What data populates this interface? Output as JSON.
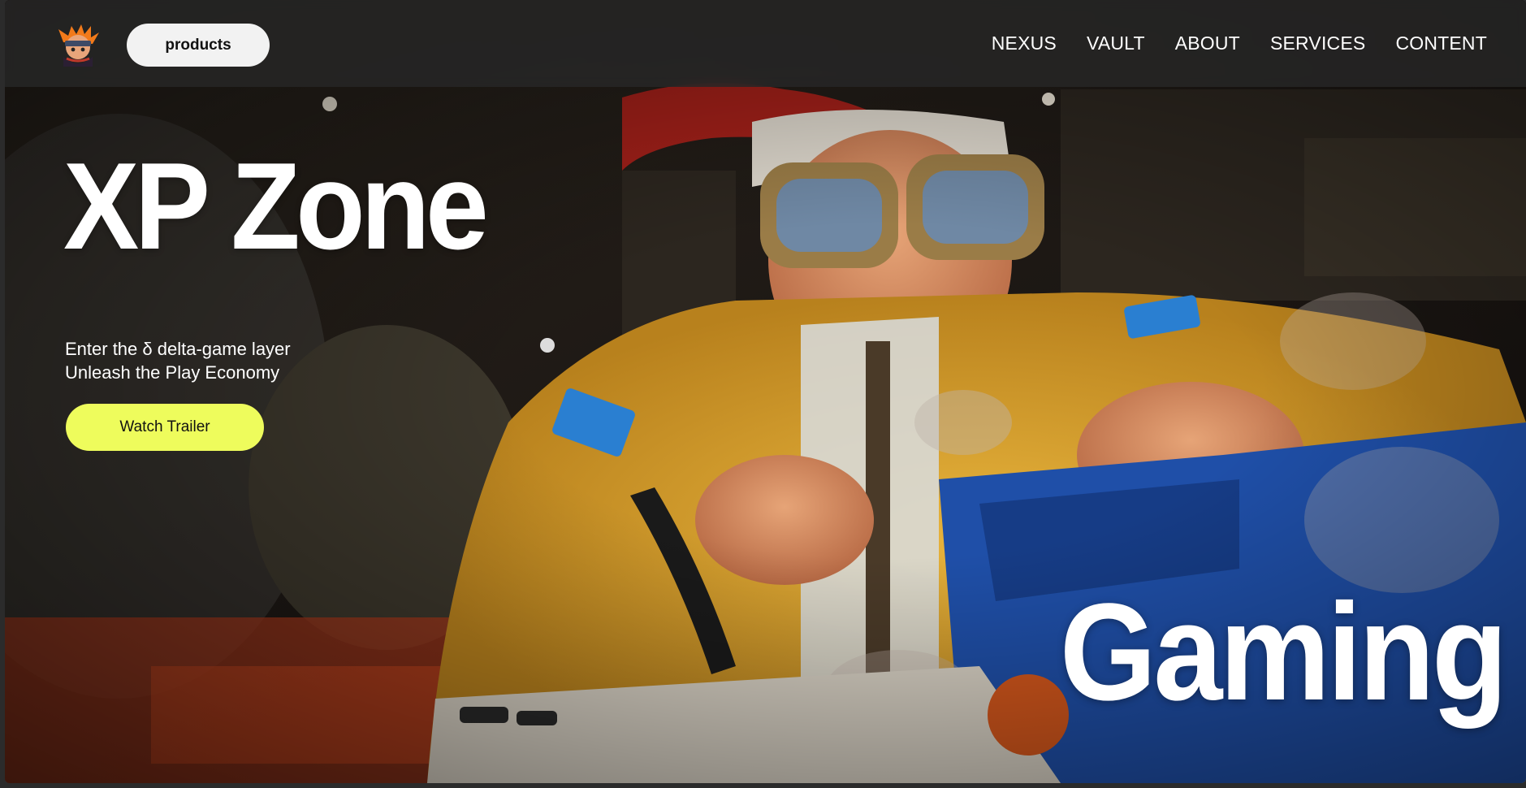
{
  "brand": {
    "logo_icon": "ninja-mascot-icon"
  },
  "header": {
    "products_label": "products",
    "nav": [
      {
        "label": "NEXUS"
      },
      {
        "label": "VAULT"
      },
      {
        "label": "ABOUT"
      },
      {
        "label": "SERVICES"
      },
      {
        "label": "CONTENT"
      }
    ]
  },
  "hero": {
    "title": "XP Zone",
    "tagline_line1": "Enter the δ delta-game layer",
    "tagline_line2": "Unleash the Play Economy",
    "cta_label": "Watch Trailer",
    "big_word": "Gaming",
    "background_image": "anime-gamer-character-artwork"
  },
  "colors": {
    "cta_accent": "#eefc5c",
    "nav_bar": "#2a2a2a",
    "products_pill": "#f2f2f2",
    "text": "#ffffff"
  }
}
